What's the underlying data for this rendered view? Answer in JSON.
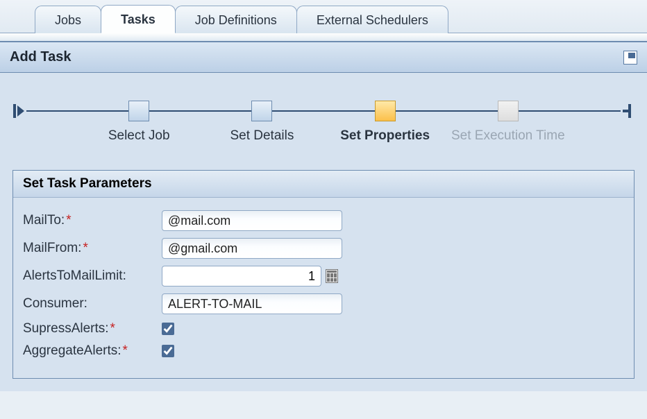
{
  "tabs": {
    "jobs": "Jobs",
    "tasks": "Tasks",
    "job_definitions": "Job Definitions",
    "external_schedulers": "External Schedulers"
  },
  "panel": {
    "title": "Add Task"
  },
  "wizard": {
    "step1": "Select Job",
    "step2": "Set  Details",
    "step3": "Set Properties",
    "step4": "Set Execution Time"
  },
  "params": {
    "section_title": "Set Task Parameters",
    "mailto_label": "MailTo:",
    "mailto_value": "@mail.com",
    "mailfrom_label": "MailFrom:",
    "mailfrom_value": "@gmail.com",
    "alerts_limit_label": "AlertsToMailLimit:",
    "alerts_limit_value": "1",
    "consumer_label": "Consumer:",
    "consumer_value": "ALERT-TO-MAIL",
    "supress_label": "SupressAlerts:",
    "aggregate_label": "AggregateAlerts:"
  }
}
